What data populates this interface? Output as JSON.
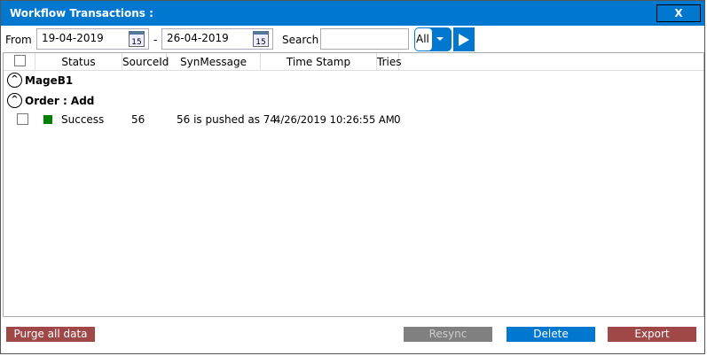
{
  "window": {
    "title": "Workflow Transactions :",
    "close_label": "X"
  },
  "toolbar": {
    "from_label": "From",
    "from_date": "19-04-2019",
    "separator": "-",
    "to_date": "26-04-2019",
    "calendar_day": "15",
    "search_label": "Search",
    "search_value": "",
    "filter_value": "All"
  },
  "grid": {
    "columns": [
      "Status",
      "SourceId",
      "SynMessage",
      "Time Stamp",
      "Tries"
    ],
    "groups": [
      "MageB1",
      "Order : Add"
    ],
    "rows": [
      {
        "status": "Success",
        "status_color": "#008000",
        "source_id": "56",
        "message": "56 is pushed as 74",
        "timestamp": "4/26/2019 10:26:55 AM",
        "tries": "0"
      }
    ]
  },
  "buttons": {
    "purge": "Purge all data",
    "resync": "Resync",
    "delete": "Delete",
    "export": "Export"
  },
  "colors": {
    "accent": "#0078d0",
    "danger": "#a04848",
    "disabled": "#808080"
  }
}
